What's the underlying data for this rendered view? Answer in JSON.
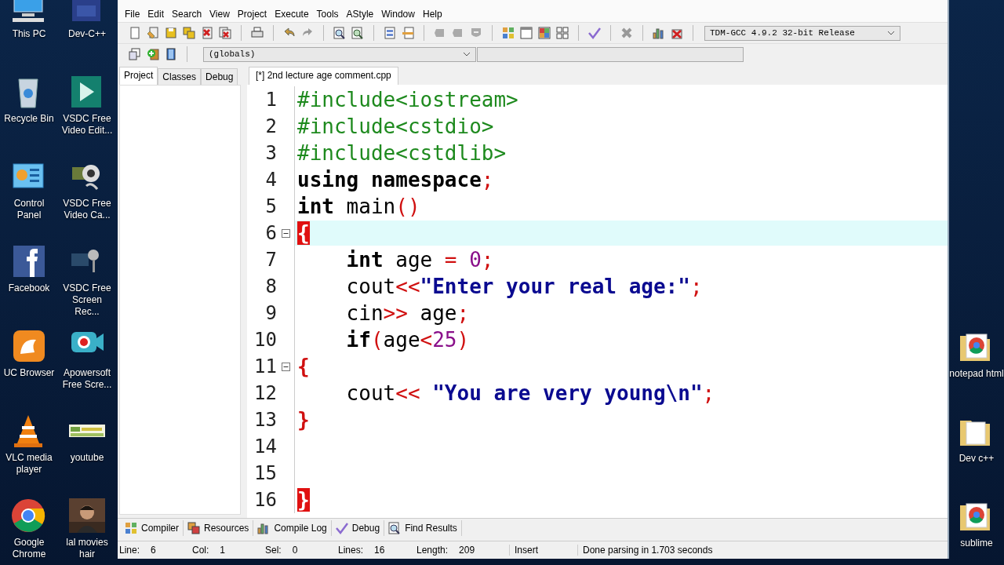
{
  "desktop_left": [
    {
      "label": "This PC",
      "kind": "pc"
    },
    {
      "label": "Dev-C++",
      "kind": "dev"
    },
    {
      "label": "Recycle Bin",
      "kind": "bin"
    },
    {
      "label": "VSDC Free Video Edit...",
      "kind": "vsdc"
    },
    {
      "label": "Control Panel",
      "kind": "panel"
    },
    {
      "label": "VSDC Free Video Ca...",
      "kind": "cam"
    },
    {
      "label": "Facebook",
      "kind": "fb"
    },
    {
      "label": "VSDC Free Screen Rec...",
      "kind": "mic"
    },
    {
      "label": "UC Browser",
      "kind": "uc"
    },
    {
      "label": "Apowersoft Free Scre...",
      "kind": "apower"
    },
    {
      "label": "VLC media player",
      "kind": "vlc"
    },
    {
      "label": "youtube",
      "kind": "thumb"
    },
    {
      "label": "Google Chrome",
      "kind": "chrome"
    },
    {
      "label": "lal movies hair",
      "kind": "picture"
    }
  ],
  "desktop_right": [
    {
      "label": "notepad html",
      "kind": "folder_chrome"
    },
    {
      "label": "Dev c++",
      "kind": "folder"
    },
    {
      "label": "sublime",
      "kind": "folder_chrome"
    }
  ],
  "menu": [
    "File",
    "Edit",
    "Search",
    "View",
    "Project",
    "Execute",
    "Tools",
    "AStyle",
    "Window",
    "Help"
  ],
  "compiler_dropdown": {
    "value": "TDM-GCC 4.9.2 32-bit Release"
  },
  "scope_dropdown": {
    "value": "(globals)"
  },
  "left_tabs": [
    {
      "label": "Project",
      "selected": true
    },
    {
      "label": "Classes",
      "selected": false
    },
    {
      "label": "Debug",
      "selected": false
    }
  ],
  "editor_tabs": [
    {
      "label": "[*] 2nd lecture age comment.cpp",
      "selected": true
    }
  ],
  "code": [
    {
      "number": "1",
      "current": false,
      "fold": false,
      "tokens": [
        {
          "text": "#include<iostream>",
          "kind": "preproc"
        }
      ]
    },
    {
      "number": "2",
      "current": false,
      "fold": false,
      "tokens": [
        {
          "text": "#include<cstdio>",
          "kind": "preproc"
        }
      ]
    },
    {
      "number": "3",
      "current": false,
      "fold": false,
      "tokens": [
        {
          "text": "#include<cstdlib>",
          "kind": "preproc"
        }
      ]
    },
    {
      "number": "4",
      "current": false,
      "fold": false,
      "tokens": [
        {
          "text": "using namespace",
          "kind": "keyword"
        },
        {
          "text": ";",
          "kind": "symbol"
        }
      ]
    },
    {
      "number": "5",
      "current": false,
      "fold": false,
      "tokens": [
        {
          "text": "int",
          "kind": "keyword"
        },
        {
          "text": " main",
          "kind": "plain"
        },
        {
          "text": "()",
          "kind": "symbol"
        }
      ]
    },
    {
      "number": "6",
      "current": true,
      "fold": true,
      "tokens": [
        {
          "text": "{",
          "kind": "brace_match"
        }
      ]
    },
    {
      "number": "7",
      "current": false,
      "fold": false,
      "tokens": [
        {
          "text": "    int",
          "kind": "keyword"
        },
        {
          "text": " age ",
          "kind": "plain"
        },
        {
          "text": "=",
          "kind": "symbol"
        },
        {
          "text": " 0",
          "kind": "number"
        },
        {
          "text": ";",
          "kind": "symbol"
        }
      ]
    },
    {
      "number": "8",
      "current": false,
      "fold": false,
      "tokens": [
        {
          "text": "    cout",
          "kind": "plain"
        },
        {
          "text": "<<",
          "kind": "symbol"
        },
        {
          "text": "\"Enter your real age:\"",
          "kind": "string"
        },
        {
          "text": ";",
          "kind": "symbol"
        }
      ]
    },
    {
      "number": "9",
      "current": false,
      "fold": false,
      "tokens": [
        {
          "text": "    cin",
          "kind": "plain"
        },
        {
          "text": ">>",
          "kind": "symbol"
        },
        {
          "text": " age",
          "kind": "plain"
        },
        {
          "text": ";",
          "kind": "symbol"
        }
      ]
    },
    {
      "number": "10",
      "current": false,
      "fold": false,
      "tokens": [
        {
          "text": "    if",
          "kind": "keyword"
        },
        {
          "text": "(",
          "kind": "symbol"
        },
        {
          "text": "age",
          "kind": "plain"
        },
        {
          "text": "<",
          "kind": "symbol"
        },
        {
          "text": "25",
          "kind": "number"
        },
        {
          "text": ")",
          "kind": "symbol"
        }
      ]
    },
    {
      "number": "11",
      "current": false,
      "fold": true,
      "tokens": [
        {
          "text": "{",
          "kind": "brace"
        }
      ]
    },
    {
      "number": "12",
      "current": false,
      "fold": false,
      "tokens": [
        {
          "text": "    cout",
          "kind": "plain"
        },
        {
          "text": "<<",
          "kind": "symbol"
        },
        {
          "text": " \"You are very young\\n\"",
          "kind": "string"
        },
        {
          "text": ";",
          "kind": "symbol"
        }
      ]
    },
    {
      "number": "13",
      "current": false,
      "fold": false,
      "tokens": [
        {
          "text": "}",
          "kind": "brace"
        }
      ]
    },
    {
      "number": "14",
      "current": false,
      "fold": false
    },
    {
      "number": "15",
      "current": false,
      "fold": false
    },
    {
      "number": "16",
      "current": false,
      "fold": false,
      "tokens": [
        {
          "text": "}",
          "kind": "brace_match"
        }
      ]
    }
  ],
  "bottom_tabs": [
    {
      "label": "Compiler",
      "kind": "compiler"
    },
    {
      "label": "Resources",
      "kind": "resources"
    },
    {
      "label": "Compile Log",
      "kind": "log"
    },
    {
      "label": "Debug",
      "kind": "debug"
    },
    {
      "label": "Find Results",
      "kind": "find"
    }
  ],
  "status_bar": [
    {
      "label": "Line:",
      "value": "6"
    },
    {
      "label": "Col:",
      "value": "1"
    },
    {
      "label": "Sel:",
      "value": "0"
    },
    {
      "label": "Lines:",
      "value": "16"
    },
    {
      "label": "Length:",
      "value": "209"
    }
  ],
  "status_mode": "Insert",
  "status_message": "Done parsing in 1.703 seconds"
}
